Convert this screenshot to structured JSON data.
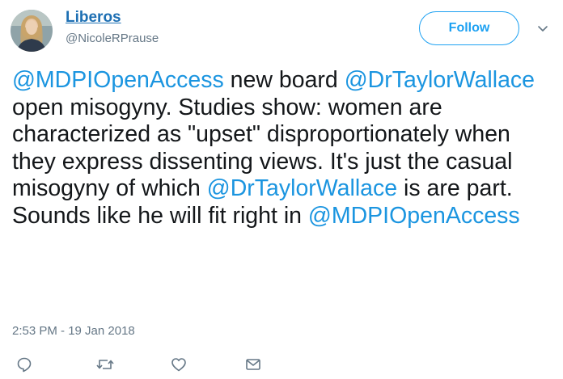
{
  "author": {
    "display_name": "Liberos",
    "handle": "@NicoleRPrause"
  },
  "follow_button": {
    "label": "Follow"
  },
  "tweet": {
    "segments": [
      {
        "type": "mention",
        "text": "@MDPIOpenAccess"
      },
      {
        "type": "text",
        "text": " new board "
      },
      {
        "type": "mention",
        "text": "@DrTaylorWallace"
      },
      {
        "type": "text",
        "text": " open misogyny. Studies show: women are characterized as \"upset\" disproportionately when they express dissenting views. It's just the casual misogyny of which "
      },
      {
        "type": "mention",
        "text": "@DrTaylorWallace"
      },
      {
        "type": "text",
        "text": " is are part. Sounds like he will fit right in "
      },
      {
        "type": "mention",
        "text": "@MDPIOpenAccess"
      }
    ],
    "timestamp": "2:53 PM - 19 Jan 2018"
  },
  "actions": [
    {
      "icon": "reply-icon"
    },
    {
      "icon": "retweet-icon"
    },
    {
      "icon": "like-icon"
    },
    {
      "icon": "direct-message-icon"
    }
  ],
  "colors": {
    "name_link": "#1d6fb3",
    "mention": "#1b95e0",
    "follow_accent": "#1da1f2",
    "muted": "#657786",
    "text": "#14171a"
  }
}
